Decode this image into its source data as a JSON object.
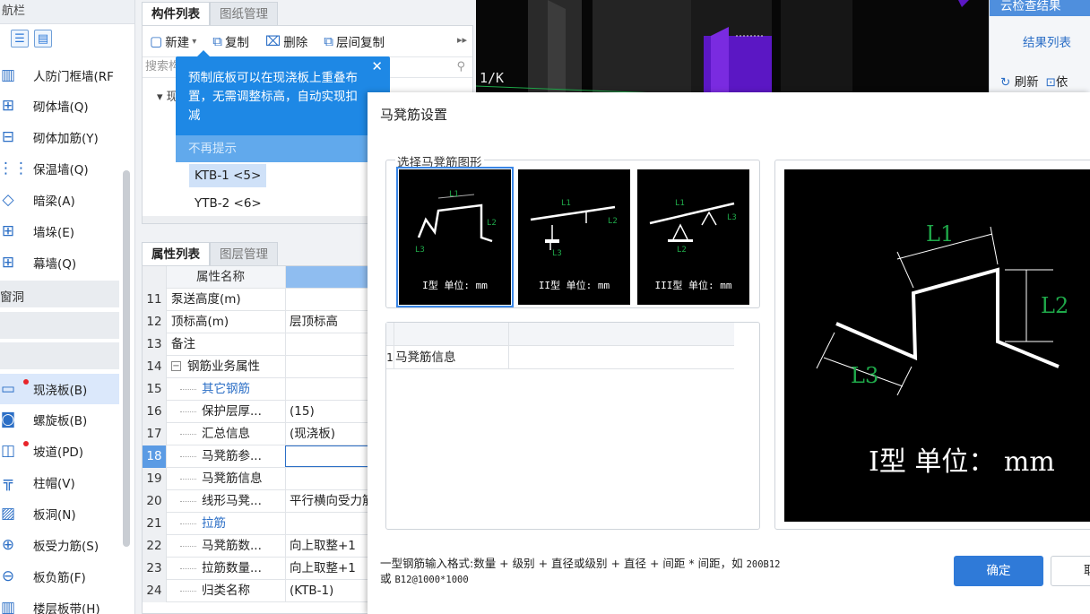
{
  "nav": {
    "title": "航栏",
    "items": [
      {
        "label": "人防门框墙(RF",
        "icon": "door-frame-wall-icon"
      },
      {
        "label": "砌体墙(Q)",
        "icon": "masonry-wall-icon"
      },
      {
        "label": "砌体加筋(Y)",
        "icon": "masonry-rebar-icon"
      },
      {
        "label": "保温墙(Q)",
        "icon": "insulation-wall-icon"
      },
      {
        "label": "暗梁(A)",
        "icon": "hidden-beam-icon"
      },
      {
        "label": "墙垛(E)",
        "icon": "wall-pier-icon"
      },
      {
        "label": "幕墙(Q)",
        "icon": "curtain-wall-icon"
      },
      {
        "label": "现浇板(B)",
        "icon": "cast-slab-icon"
      },
      {
        "label": "螺旋板(B)",
        "icon": "spiral-slab-icon"
      },
      {
        "label": "坡道(PD)",
        "icon": "ramp-icon"
      },
      {
        "label": "柱帽(V)",
        "icon": "column-cap-icon"
      },
      {
        "label": "板洞(N)",
        "icon": "slab-opening-icon"
      },
      {
        "label": "板受力筋(S)",
        "icon": "slab-main-rebar-icon"
      },
      {
        "label": "板负筋(F)",
        "icon": "slab-negative-rebar-icon"
      },
      {
        "label": "楼层板带(H)",
        "icon": "floor-strip-icon"
      }
    ],
    "section_label": "窗洞"
  },
  "component_panel": {
    "tabs": [
      "构件列表",
      "图纸管理"
    ],
    "toolbar": {
      "new": "新建",
      "copy": "复制",
      "delete": "删除",
      "floor_copy": "层间复制"
    },
    "search_placeholder": "搜索构",
    "tree_root": "▾ 现",
    "tree_items": [
      "KTB-1 <5>",
      "YTB-2 <6>"
    ]
  },
  "tooltip": {
    "message": "预制底板可以在现浇板上重叠布置，无需调整标高，自动实现扣减",
    "dismiss": "不再提示"
  },
  "property_panel": {
    "tabs": [
      "属性列表",
      "图层管理"
    ],
    "header": {
      "name": "属性名称",
      "value": "属性值"
    },
    "rows": [
      {
        "num": "11",
        "name": "泵送高度(m)",
        "value": ""
      },
      {
        "num": "12",
        "name": "顶标高(m)",
        "value": "层顶标高"
      },
      {
        "num": "13",
        "name": "备注",
        "value": ""
      },
      {
        "num": "14",
        "name": "钢筋业务属性",
        "value": ""
      },
      {
        "num": "15",
        "name": "其它钢筋",
        "value": ""
      },
      {
        "num": "16",
        "name": "保护层厚...",
        "value": "(15)"
      },
      {
        "num": "17",
        "name": "汇总信息",
        "value": "(现浇板)"
      },
      {
        "num": "18",
        "name": "马凳筋参...",
        "value": ""
      },
      {
        "num": "19",
        "name": "马凳筋信息",
        "value": ""
      },
      {
        "num": "20",
        "name": "线形马凳...",
        "value": "平行横向受力筋"
      },
      {
        "num": "21",
        "name": "拉筋",
        "value": ""
      },
      {
        "num": "22",
        "name": "马凳筋数...",
        "value": "向上取整+1"
      },
      {
        "num": "23",
        "name": "拉筋数量...",
        "value": "向上取整+1"
      },
      {
        "num": "24",
        "name": "归类名称",
        "value": "(KTB-1)"
      }
    ]
  },
  "viewport": {
    "axis_label": "1/K"
  },
  "right_panel": {
    "header": "云检查结果",
    "title": "结果列表",
    "refresh": "刷新",
    "depend": "依"
  },
  "dialog": {
    "title": "马凳筋设置",
    "shape_group_label": "选择马凳筋图形",
    "shapes": [
      {
        "caption": "I型 单位: mm"
      },
      {
        "caption": "II型 单位: mm"
      },
      {
        "caption": "III型 单位: mm"
      }
    ],
    "table": {
      "row_num": "1",
      "row_label": "马凳筋信息"
    },
    "preview": {
      "l1": "L1",
      "l2": "L2",
      "l3": "L3",
      "caption": "I型 单位： mm"
    },
    "note_line1": "一型钢筋输入格式:数量 + 级别 + 直径或级别 + 直径 + 间距 * 间距，如 ",
    "note_example1": "200B12",
    "note_or": "或 ",
    "note_example2": "B12@1000*1000",
    "ok": "确定",
    "cancel": "取消"
  }
}
